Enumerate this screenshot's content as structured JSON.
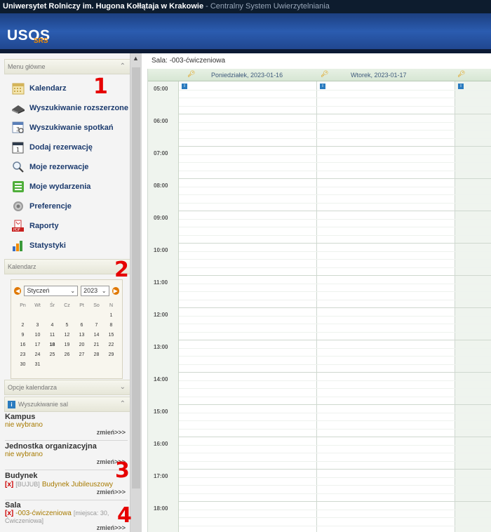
{
  "topbar": {
    "university": "Uniwersytet Rolniczy im. Hugona Kołłątaja w Krakowie",
    "system": " - Centralny System Uwierzytelniania"
  },
  "banner": {
    "logo": "USOS",
    "logo_sub": "SRS"
  },
  "sidebar": {
    "main_menu_title": "Menu główne",
    "menu_items": [
      {
        "label": "Kalendarz",
        "icon": "calendar-icon"
      },
      {
        "label": "Wyszukiwanie rozszerzone",
        "icon": "books-icon"
      },
      {
        "label": "Wyszukiwanie spotkań",
        "icon": "calendar-search-icon"
      },
      {
        "label": "Dodaj rezerwację",
        "icon": "calendar-add-icon"
      },
      {
        "label": "Moje rezerwacje",
        "icon": "magnifier-icon"
      },
      {
        "label": "Moje wydarzenia",
        "icon": "list-icon"
      },
      {
        "label": "Preferencje",
        "icon": "gear-icon"
      },
      {
        "label": "Raporty",
        "icon": "pdf-icon"
      },
      {
        "label": "Statystyki",
        "icon": "bar-chart-icon"
      }
    ],
    "calendar_title": "Kalendarz",
    "calendar": {
      "month": "Styczeń",
      "year": "2023",
      "weekdays": [
        "Pn",
        "Wt",
        "Śr",
        "Cz",
        "Pt",
        "So",
        "N"
      ],
      "weeks": [
        [
          "",
          "",
          "",
          "",
          "",
          "",
          "1"
        ],
        [
          "2",
          "3",
          "4",
          "5",
          "6",
          "7",
          "8"
        ],
        [
          "9",
          "10",
          "11",
          "12",
          "13",
          "14",
          "15"
        ],
        [
          "16",
          "17",
          "18",
          "19",
          "20",
          "21",
          "22"
        ],
        [
          "23",
          "24",
          "25",
          "26",
          "27",
          "28",
          "29"
        ],
        [
          "30",
          "31",
          "",
          "",
          "",
          "",
          ""
        ]
      ],
      "today": "18"
    },
    "options_title": "Opcje kalendarza",
    "room_search_title": "Wyszukiwanie sal",
    "filters": {
      "campus": {
        "title": "Kampus",
        "value": "nie wybrano",
        "change": "zmień>>>"
      },
      "unit": {
        "title": "Jednostka organizacyjna",
        "value": "nie wybrano",
        "change": "zmień>>>"
      },
      "building": {
        "title": "Budynek",
        "x": "[x]",
        "code": "[BUJUB]",
        "value": "Budynek Jubileuszowy",
        "change": "zmień>>>"
      },
      "room": {
        "title": "Sala",
        "x": "[x]",
        "value": "-003-ćwiczeniowa",
        "meta": "[miejsca: 30, Ćwiczeniowa]",
        "change": "zmień>>>"
      }
    }
  },
  "annotations": [
    "1",
    "2",
    "3",
    "4"
  ],
  "main": {
    "breadcrumb": "Sala: -003-ćwiczeniowa",
    "days": [
      {
        "label": "Poniedziałek, 2023-01-16"
      },
      {
        "label": "Wtorek, 2023-01-17"
      },
      {
        "label": ""
      }
    ],
    "hours": [
      "05:00",
      "06:00",
      "07:00",
      "08:00",
      "09:00",
      "10:00",
      "11:00",
      "12:00",
      "13:00",
      "14:00",
      "15:00",
      "16:00",
      "17:00",
      "18:00"
    ]
  },
  "colors": {
    "accent": "#e07800",
    "annotation": "#e60000",
    "banner": "#1c3f80"
  }
}
